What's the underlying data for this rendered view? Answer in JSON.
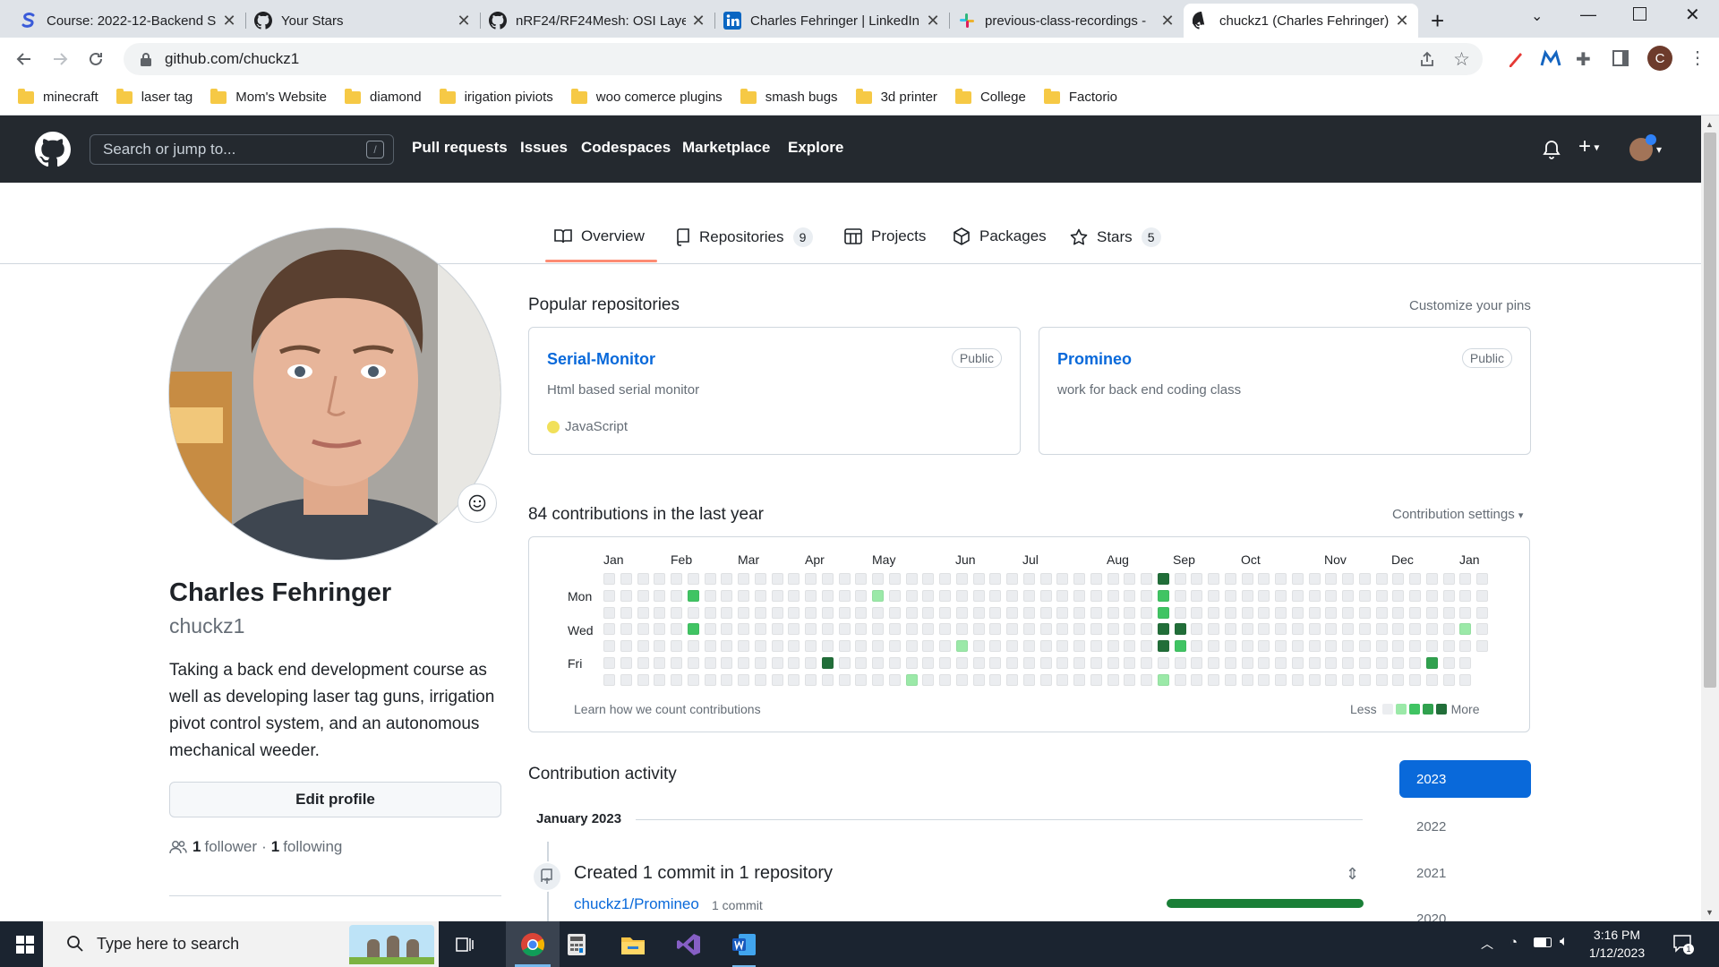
{
  "browser": {
    "tabs": [
      {
        "title": "Course: 2022-12-Backend S",
        "icon": "s-logo-icon"
      },
      {
        "title": "Your Stars",
        "icon": "github-icon"
      },
      {
        "title": "nRF24/RF24Mesh: OSI Laye",
        "icon": "github-icon"
      },
      {
        "title": "Charles Fehringer | LinkedIn",
        "icon": "linkedin-icon"
      },
      {
        "title": "previous-class-recordings -",
        "icon": "slack-icon"
      },
      {
        "title": "chuckz1 (Charles Fehringer)",
        "icon": "github-icon"
      }
    ],
    "url": "github.com/chuckz1",
    "profile_initial": "C",
    "bookmarks": [
      "minecraft",
      "laser tag",
      "Mom's Website",
      "diamond",
      "irigation piviots",
      "woo comerce plugins",
      "smash bugs",
      "3d printer",
      "College",
      "Factorio"
    ]
  },
  "github": {
    "search_placeholder": "Search or jump to...",
    "search_shortcut": "/",
    "nav": [
      "Pull requests",
      "Issues",
      "Codespaces",
      "Marketplace",
      "Explore"
    ],
    "tabs": {
      "overview": "Overview",
      "repositories": "Repositories",
      "repositories_count": "9",
      "projects": "Projects",
      "packages": "Packages",
      "stars": "Stars",
      "stars_count": "5"
    },
    "profile": {
      "name": "Charles Fehringer",
      "username": "chuckz1",
      "bio": "Taking a back end development course as well as developing laser tag guns, irrigation pivot control system, and an autonomous mechanical weeder.",
      "edit_label": "Edit profile",
      "followers_count": "1",
      "followers_label": "follower",
      "following_count": "1",
      "following_label": "following"
    },
    "popular": {
      "title": "Popular repositories",
      "customize": "Customize your pins",
      "repos": [
        {
          "name": "Serial-Monitor",
          "visibility": "Public",
          "description": "Html based serial monitor",
          "language": "JavaScript"
        },
        {
          "name": "Promineo",
          "visibility": "Public",
          "description": "work for back end coding class",
          "language": ""
        }
      ]
    },
    "contributions": {
      "title": "84 contributions in the last year",
      "settings": "Contribution settings",
      "months": [
        "Jan",
        "Feb",
        "Mar",
        "Apr",
        "May",
        "Jun",
        "Jul",
        "Aug",
        "Sep",
        "Oct",
        "Nov",
        "Dec",
        "Jan"
      ],
      "days": [
        "Mon",
        "Wed",
        "Fri"
      ],
      "learn": "Learn how we count contributions",
      "less": "Less",
      "more": "More",
      "level_colors": [
        "#ebedf0",
        "#9be9a8",
        "#40c463",
        "#30a14e",
        "#216e39"
      ],
      "grid_weeks": 53,
      "active_cells": [
        {
          "week": 5,
          "day": 1,
          "level": 2
        },
        {
          "week": 5,
          "day": 3,
          "level": 2
        },
        {
          "week": 13,
          "day": 5,
          "level": 4
        },
        {
          "week": 16,
          "day": 1,
          "level": 1
        },
        {
          "week": 18,
          "day": 6,
          "level": 1
        },
        {
          "week": 21,
          "day": 4,
          "level": 1
        },
        {
          "week": 33,
          "day": 0,
          "level": 4
        },
        {
          "week": 33,
          "day": 1,
          "level": 2
        },
        {
          "week": 33,
          "day": 2,
          "level": 2
        },
        {
          "week": 33,
          "day": 3,
          "level": 4
        },
        {
          "week": 33,
          "day": 4,
          "level": 4
        },
        {
          "week": 33,
          "day": 6,
          "level": 1
        },
        {
          "week": 34,
          "day": 3,
          "level": 4
        },
        {
          "week": 34,
          "day": 4,
          "level": 2
        },
        {
          "week": 49,
          "day": 5,
          "level": 3
        },
        {
          "week": 51,
          "day": 3,
          "level": 1
        }
      ]
    },
    "activity": {
      "title": "Contribution activity",
      "years": [
        "2023",
        "2022",
        "2021",
        "2020"
      ],
      "selected_year": "2023",
      "month": "January 2023",
      "summary": "Created 1 commit in 1 repository",
      "repo": "chuckz1/Promineo",
      "commits": "1 commit",
      "commit_fraction": 1.0
    }
  },
  "taskbar": {
    "search_placeholder": "Type here to search",
    "time": "3:16 PM",
    "date": "1/12/2023"
  }
}
